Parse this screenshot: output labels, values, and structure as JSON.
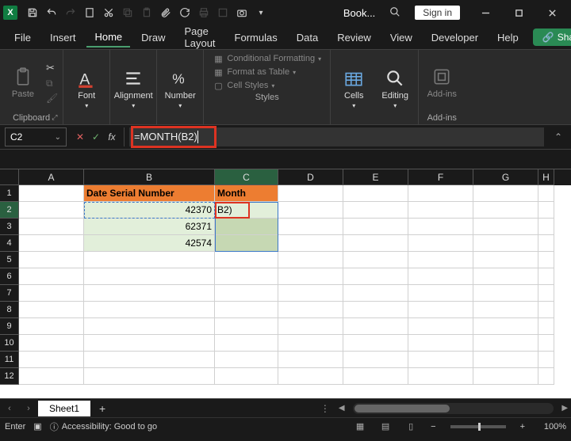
{
  "titlebar": {
    "doc_name": "Book...",
    "signin": "Sign in"
  },
  "tabs": {
    "file": "File",
    "insert": "Insert",
    "home": "Home",
    "draw": "Draw",
    "page_layout": "Page Layout",
    "formulas": "Formulas",
    "data": "Data",
    "review": "Review",
    "view": "View",
    "developer": "Developer",
    "help": "Help",
    "share": "Share"
  },
  "ribbon": {
    "paste": "Paste",
    "font": "Font",
    "alignment": "Alignment",
    "number": "Number",
    "cond_fmt": "Conditional Formatting",
    "fmt_table": "Format as Table",
    "cell_styles": "Cell Styles",
    "cells": "Cells",
    "editing": "Editing",
    "addins": "Add-ins",
    "group_clipboard": "Clipboard",
    "group_styles": "Styles",
    "group_addins": "Add-ins"
  },
  "formula_bar": {
    "name_box": "C2",
    "formula_prefix": "=MONTH(",
    "formula_ref": "B2",
    "formula_suffix": ")"
  },
  "grid": {
    "cols": [
      "A",
      "B",
      "C",
      "D",
      "E",
      "F",
      "G",
      "H"
    ],
    "rows": [
      "1",
      "2",
      "3",
      "4",
      "5",
      "6",
      "7",
      "8",
      "9",
      "10",
      "11",
      "12"
    ],
    "headers": {
      "b1": "Date Serial Number",
      "c1": "Month"
    },
    "data": {
      "b2": "42370",
      "b3": "62371",
      "b4": "42574"
    },
    "editing_cell": "B2)"
  },
  "sheet_tabs": {
    "sheet1": "Sheet1"
  },
  "statusbar": {
    "mode": "Enter",
    "accessibility": "Accessibility: Good to go",
    "zoom": "100%"
  }
}
